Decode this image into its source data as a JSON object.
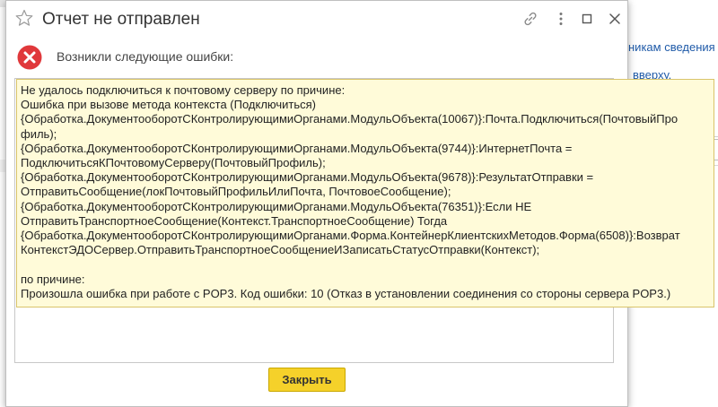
{
  "background": {
    "fragment_1": "никам сведения",
    "fragment_2": "вверху."
  },
  "dialog": {
    "title": "Отчет не отправлен",
    "error_caption": "Возникли следующие ошибки:",
    "message_lines": [
      "Не удалось подключиться к почтовому серверу по причине:",
      "Ошибка при вызове метода контекста (Подключиться)",
      "{Обработка.ДокументооборотСКонтролирующимиОрганами.МодульОбъекта(10067)}:Почта.Подключиться(ПочтовыйПро",
      "филь);",
      "{Обработка.ДокументооборотСКонтролирующимиОрганами.МодульОбъекта(9744)}:ИнтернетПочта =",
      "ПодключитьсяКПочтовомуСерверу(ПочтовыйПрофиль);",
      "{Обработка.ДокументооборотСКонтролирующимиОрганами.МодульОбъекта(9678)}:РезультатОтправки =",
      "ОтправитьСообщение(локПочтовыйПрофильИлиПочта, ПочтовоеСообщение);",
      "{Обработка.ДокументооборотСКонтролирующимиОрганами.МодульОбъекта(76351)}:Если НЕ",
      "ОтправитьТранспортноеСообщение(Контекст.ТранспортноеСообщение) Тогда",
      "{Обработка.ДокументооборотСКонтролирующимиОрганами.Форма.КонтейнерКлиентскихМетодов.Форма(6508)}:Возврат",
      "КонтекстЭДОСервер.ОтправитьТранспортноеСообщениеИЗаписатьСтатусОтправки(Контекст);",
      "",
      "по причине:",
      "Произошла ошибка при работе с POP3. Код ошибки: 10 (Отказ в установлении соединения со стороны сервера POP3.)"
    ],
    "close_button_label": "Закрыть"
  },
  "icons": {
    "star": "star-icon",
    "link": "link-icon",
    "menu": "kebab-menu-icon",
    "maximize": "maximize-icon",
    "close": "close-icon",
    "error": "error-x-icon"
  },
  "colors": {
    "error_red": "#e0383b",
    "message_background": "#fffbd9",
    "button_yellow": "#f5d12a",
    "link_blue": "#1f5aa8"
  }
}
